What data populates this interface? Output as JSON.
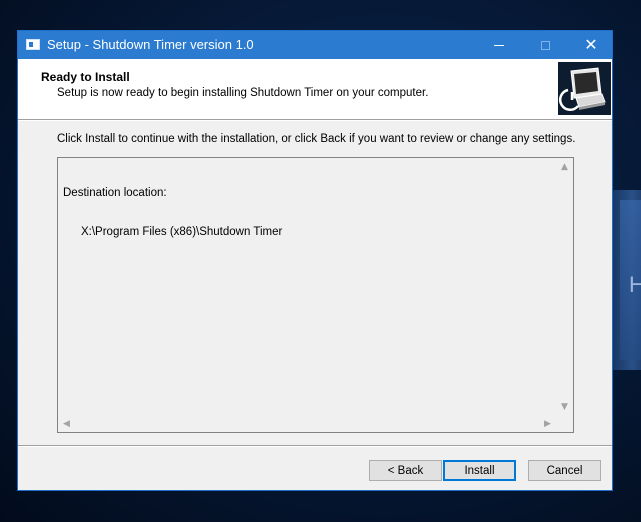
{
  "window": {
    "title": "Setup - Shutdown Timer version 1.0"
  },
  "header": {
    "title": "Ready to Install",
    "subtitle": "Setup is now ready to begin installing Shutdown Timer on your computer."
  },
  "body": {
    "instruction": "Click Install to continue with the installation, or click Back if you want to review or change any settings.",
    "memo": {
      "label": "Destination location:",
      "path": "X:\\Program Files (x86)\\Shutdown Timer"
    }
  },
  "buttons": {
    "back": "< Back",
    "install": "Install",
    "cancel": "Cancel"
  },
  "icons": {
    "app": "setup-app-icon",
    "wizard": "computer-shutdown-wizard-image",
    "minimize": "minimize-icon",
    "maximize": "maximize-icon",
    "close": "close-icon"
  },
  "colors": {
    "titlebar": "#2b7bd0",
    "default_button_border": "#0078d7"
  }
}
